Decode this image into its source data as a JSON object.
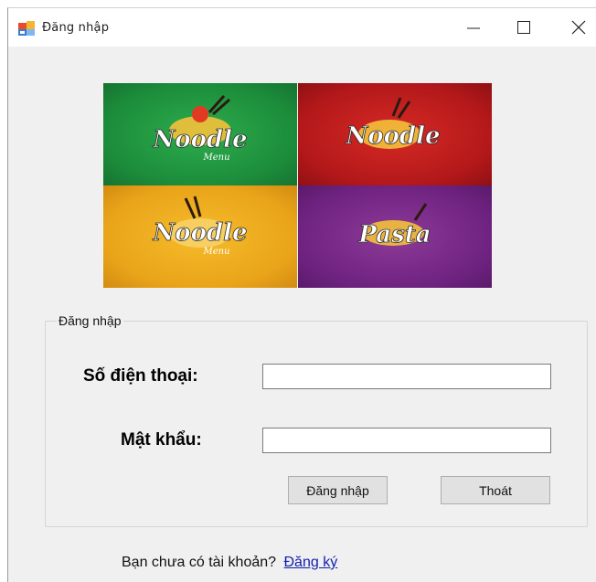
{
  "window": {
    "title": "Đăng nhập",
    "icon": "winforms-app-icon",
    "controls": [
      "minimize-icon",
      "maximize-icon",
      "close-icon"
    ]
  },
  "banner": {
    "tiles": [
      {
        "text": "Noodle",
        "subtext": "Menu",
        "color": "#1e9442"
      },
      {
        "text": "Noodle",
        "subtext": "",
        "color": "#c41d1f"
      },
      {
        "text": "Noodle",
        "subtext": "Menu",
        "color": "#f0ad1f"
      },
      {
        "text": "Pasta",
        "subtext": "",
        "color": "#7a2a8a"
      }
    ]
  },
  "login_group": {
    "legend": "Đăng nhập",
    "phone_label": "Số điện thoại:",
    "phone_value": "",
    "password_label": "Mật khẩu:",
    "password_value": "",
    "login_button": "Đăng nhập",
    "exit_button": "Thoát"
  },
  "footer": {
    "prompt": "Bạn chưa có tài khoản?",
    "register_link": "Đăng ký",
    "link_color": "#0f1fb0"
  }
}
